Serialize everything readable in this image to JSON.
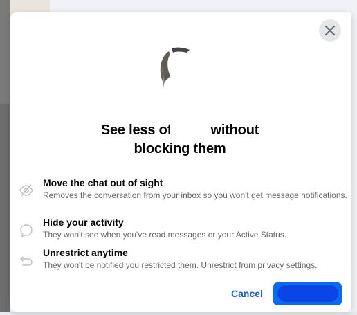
{
  "dialog": {
    "title_prefix": "See less of",
    "title_suffix": " without",
    "title_line2": "blocking them",
    "close_icon": "close-icon"
  },
  "items": [
    {
      "icon": "eye-slash-icon",
      "title": "Move the chat out of sight",
      "description": "Removes the conversation from your inbox so you won't get message notifications."
    },
    {
      "icon": "chat-bubble-icon",
      "title": "Hide your activity",
      "description": "They won't see when you've read messages or your Active Status."
    },
    {
      "icon": "undo-arrow-icon",
      "title": "Unrestrict anytime",
      "description": "They won't be notified you restricted them. Unrestrict from privacy settings."
    }
  ],
  "buttons": {
    "cancel": "Cancel"
  },
  "colors": {
    "link_blue": "#1763cf",
    "primary_blue": "#0a6af0",
    "close_bg": "#e4e6eb"
  }
}
